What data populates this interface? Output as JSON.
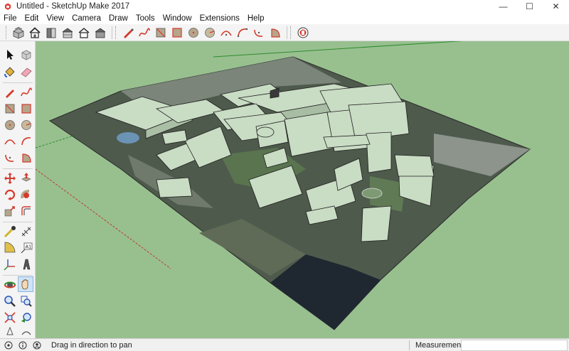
{
  "window": {
    "title": "Untitled - SketchUp Make 2017",
    "app_icon": "sketchup-logo-icon",
    "minimize_glyph": "—",
    "maximize_glyph": "☐",
    "close_glyph": "✕"
  },
  "menu": {
    "items": [
      {
        "label": "File"
      },
      {
        "label": "Edit"
      },
      {
        "label": "View"
      },
      {
        "label": "Camera"
      },
      {
        "label": "Draw"
      },
      {
        "label": "Tools"
      },
      {
        "label": "Window"
      },
      {
        "label": "Extensions"
      },
      {
        "label": "Help"
      }
    ]
  },
  "toolbar": {
    "view_buttons": [
      "iso-view-icon",
      "top-view-icon",
      "front-view-icon",
      "right-view-icon",
      "back-view-icon",
      "left-view-icon"
    ],
    "draw_buttons": [
      "pencil-icon",
      "freehand-icon",
      "rectangle-icon",
      "rotated-rectangle-icon",
      "circle-icon",
      "polygon-icon",
      "arc-icon",
      "two-point-arc-icon",
      "three-point-arc-icon",
      "pie-icon"
    ],
    "extra_buttons": [
      "warehouse-icon"
    ]
  },
  "left_toolbar": {
    "tools": [
      "select-icon",
      "make-component-icon",
      "paint-bucket-icon",
      "eraser-icon",
      "pencil-icon",
      "freehand-icon",
      "rectangle-icon",
      "rotated-rectangle-icon",
      "circle-icon",
      "polygon-icon",
      "arc-icon",
      "two-point-arc-icon",
      "three-point-arc-icon",
      "pie-icon",
      "move-icon",
      "push-pull-icon",
      "rotate-icon",
      "follow-me-icon",
      "scale-icon",
      "offset-icon",
      "tape-measure-icon",
      "dimension-icon",
      "protractor-icon",
      "text-icon",
      "axes-icon",
      "3d-text-icon",
      "orbit-icon",
      "pan-icon",
      "zoom-icon",
      "zoom-window-icon",
      "zoom-extents-icon",
      "previous-view-icon"
    ],
    "active_tool": "pan-icon"
  },
  "viewport": {
    "background_color": "#98c08f",
    "axis_red": "#c0392b",
    "axis_green": "#2e8b2e",
    "axis_blue": "#2c55b8"
  },
  "status": {
    "message": "Drag in direction to pan",
    "measurements_label": "Measurements",
    "measurements_value": ""
  }
}
